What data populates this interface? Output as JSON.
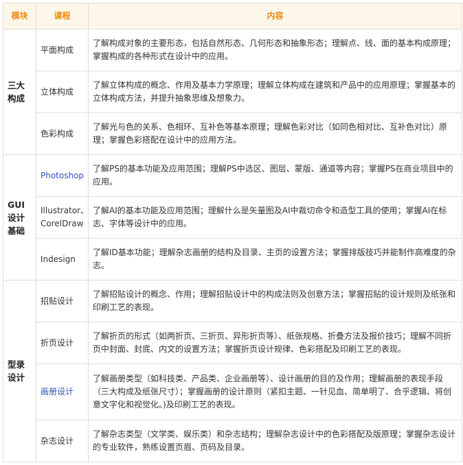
{
  "headers": {
    "module": "模块",
    "course": "课程",
    "content": "内容"
  },
  "groups": [
    {
      "module": "三大构成",
      "rows": [
        {
          "course": "平面构成",
          "link": false,
          "content": "了解构成对象的主要形态，包括自然形态、几何形态和抽象形态；理解点、线、面的基本构成原理；掌握构成的各种形式在设计中的应用。"
        },
        {
          "course": "立体构成",
          "link": false,
          "content": "了解立体构成的概念、作用及基本力学原理；理解立体构成在建筑和产品中的应用原理；掌握基本的立体构成方法，并提升抽象思维及想象力。"
        },
        {
          "course": "色彩构成",
          "link": false,
          "content": "了解光与色的关系、色相环、互补色等基本原理；理解色彩对比（如同色相对比、互补色对比）原理；掌握色彩搭配在设计中的应用方法。"
        }
      ]
    },
    {
      "module": "GUI设计基础",
      "rows": [
        {
          "course": "Photoshop",
          "link": true,
          "content": "了解PS的基本功能及应用范围；理解PS中选区、图层、蒙版、通道等内容；掌握PS在商业项目中的应用。"
        },
        {
          "course": "Illustrator、CorelDraw",
          "link": false,
          "content": "了解AI的基本功能及应用范围；理解什么是矢量图及AI中裁切命令和造型工具的使用；掌握AI在标志、字体等设计中的应用。"
        },
        {
          "course": "Indesign",
          "link": false,
          "content": "了解ID基本功能；理解杂志画册的结构及目录、主页的设置方法；掌握排版技巧并能制作高难度的杂志。"
        }
      ]
    },
    {
      "module": "型录设计",
      "rows": [
        {
          "course": "招贴设计",
          "link": false,
          "content": "了解招贴设计的概念、作用；理解招贴设计中的构成法则及创意方法；掌握招贴的设计规则及纸张和印刷工艺的表现。"
        },
        {
          "course": "折页设计",
          "link": false,
          "content": "了解折页的形式（如两折页、三折页、异形折页等）、纸张规格、折叠方法及报价技巧；理解不同折页中封面、封底、内文的设置方法；掌握折页设计规律、色彩搭配及印刷工艺的表现。"
        },
        {
          "course": "画册设计",
          "link": true,
          "content": "了解画册类型（如科技类、产品类、企业画册等）、设计画册的目的及作用；理解画册的表现手段（三大构成及纸张尺寸）；掌握画册的设计原则（紧扣主题、一针见血、简单明了、合乎逻辑、将创意文字化和视觉化。)及印刷工艺的表现。"
        },
        {
          "course": "杂志设计",
          "link": false,
          "content": "了解杂志类型（文学类、娱乐类）和杂志结构；理解杂志设计中的色彩搭配及版原理；掌握杂志设计的专业软件，熟练设置页眉、页码及目录。"
        }
      ]
    }
  ]
}
